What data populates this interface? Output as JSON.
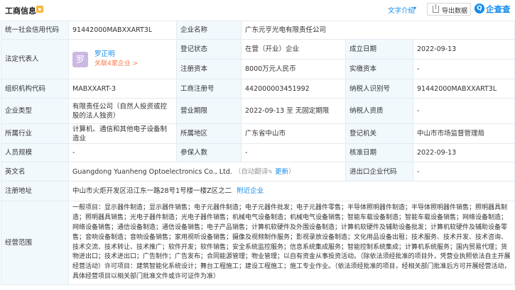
{
  "header": {
    "title": "工商信息",
    "intro_link": "文字介绍",
    "export_label": "导出数据",
    "brand_mark": "Q",
    "brand_text": "企查查"
  },
  "company": {
    "credit_code_label": "统一社会信用代码",
    "credit_code": "91442000MABXXART3L",
    "name_label": "企业名称",
    "name": "广东元亨光电有限责任公司",
    "legal_rep_label": "法定代表人",
    "legal_rep_avatar": "罗",
    "legal_rep_name": "罗正明",
    "legal_rep_related": "关联4家企业 >",
    "reg_status_label": "登记状态",
    "reg_status": "在营（开业）企业",
    "established_label": "成立日期",
    "established": "2022-09-13",
    "reg_capital_label": "注册资本",
    "reg_capital": "8000万元人民币",
    "paid_capital_label": "实缴资本",
    "paid_capital": "-",
    "org_code_label": "组织机构代码",
    "org_code": "MABXXART-3",
    "reg_no_label": "工商注册号",
    "reg_no": "442000003451992",
    "taxpayer_id_label": "纳税人识别号",
    "taxpayer_id": "91442000MABXXART3L",
    "type_label": "企业类型",
    "type": "有限责任公司（自然人投资或控股的法人独资）",
    "term_label": "营业期限",
    "term": "2022-09-13 至 无固定期限",
    "taxpayer_qual_label": "纳税人资质",
    "taxpayer_qual": "-",
    "industry_label": "所属行业",
    "industry": "计算机、通信和其他电子设备制造业",
    "region_label": "所属地区",
    "region": "广东省中山市",
    "authority_label": "登记机关",
    "authority": "中山市市场监督管理局",
    "staff_label": "人员规模",
    "staff": "-",
    "insured_label": "参保人数",
    "insured": "-",
    "approved_label": "核准日期",
    "approved": "2022-09-13",
    "en_name_label": "英文名",
    "en_name": "Guangdong Yuanheng Optoelectronics Co., Ltd.",
    "en_name_note": "（自动翻译",
    "en_name_update": "更新",
    "en_name_close": "）",
    "import_export_label": "进出口企业代码",
    "import_export": "-",
    "address_label": "注册地址",
    "address": "中山市火炬开发区沿江东一路28号1号楼一楼Z区之二",
    "address_link": "附近企业",
    "scope_label": "经营范围",
    "scope": "一般项目：显示器件制造；显示器件销售；电子元器件制造；电子元器件批发；电子元器件零售；半导体照明器件制造；半导体照明器件销售；照明器具制造；照明器具销售；光电子器件制造；光电子器件销售；机械电气设备制造；机械电气设备销售；智能车载设备制造；智能车载设备销售；网络设备制造；网络设备销售；通信设备制造；通信设备销售；电子产品销售；计算机软硬件及外围设备制造；计算机软硬件及辅助设备批发；计算机软硬件及辅助设备零售；音响设备制造；音响设备销售；家用视听设备销售；摄像及视频制作服务；影视录放设备制造；文化用品设备出租；技术服务、技术开发、技术咨询、技术交流、技术转让、技术推广；软件开发；软件销售；安全系统监控服务；信息系统集成服务；智能控制系统集成；计算机系统服务；国内贸易代理；货物进出口；技术进出口；广告制作；广告发布；合同能源管理；物业管理；以自有资金从事投资活动。（除依法须经批准的项目外，凭营业执照依法自主开展经营活动）许可项目：建筑智能化系统设计；舞台工程施工；建设工程施工；施工专业作业。（依法须经批准的项目，经相关部门批准后方可开展经营活动，具体经营项目以相关部门批准文件或许可证件为准）"
  }
}
